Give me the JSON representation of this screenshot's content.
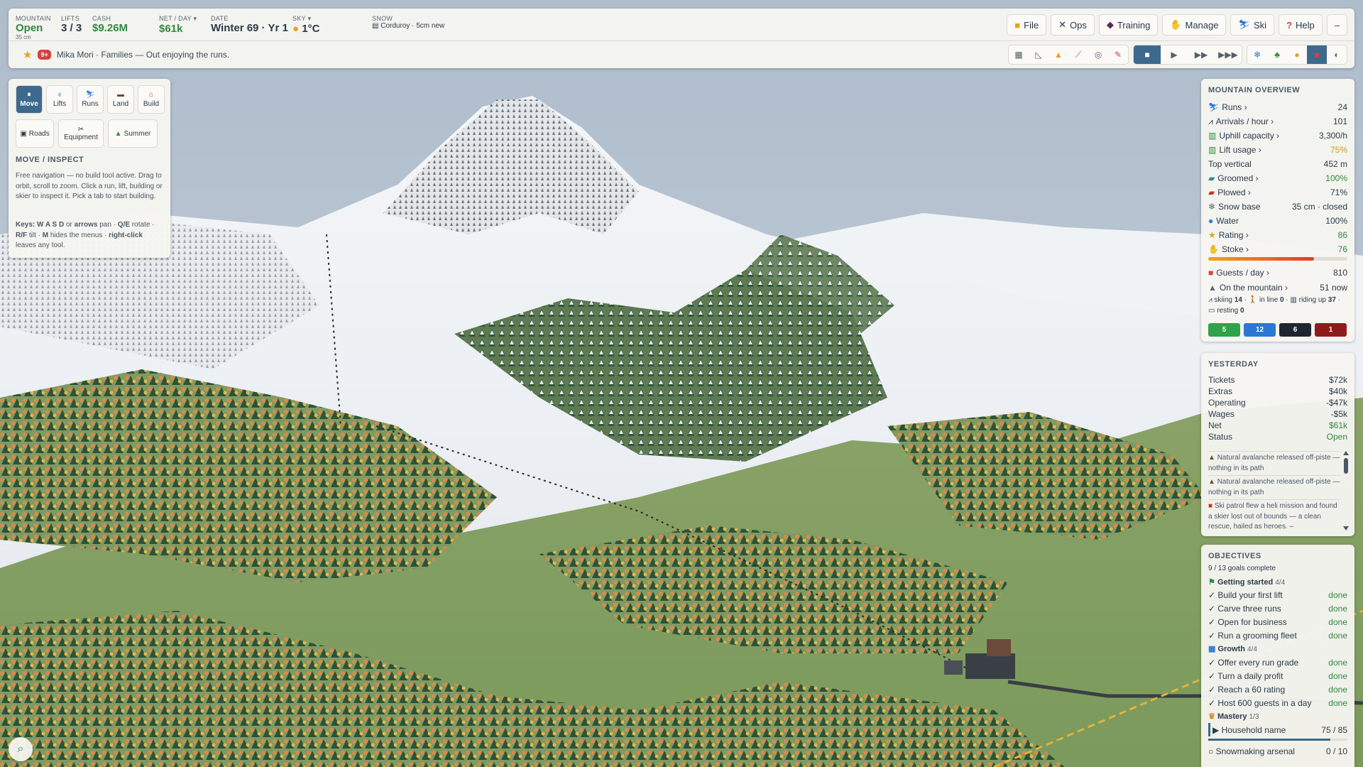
{
  "topbar": {
    "mountain": {
      "label": "Mountain",
      "value": "Open",
      "sub": "35 cm"
    },
    "lifts": {
      "label": "Lifts",
      "value": "3 / 3"
    },
    "cash": {
      "label": "Cash",
      "value": "$9.26M"
    },
    "net": {
      "label": "Net / Day ▾",
      "value": "$61k"
    },
    "date": {
      "label": "Date",
      "value": "Winter 69 · Yr 1"
    },
    "sky": {
      "label": "Sky ▾",
      "value": "1°C"
    },
    "snow": {
      "label": "Snow",
      "value": "Corduroy · 5cm new"
    },
    "menus": [
      "File",
      "Ops",
      "Training",
      "Manage",
      "Ski",
      "Help"
    ],
    "collapse": "–",
    "news": {
      "count": "9+",
      "text": "Mika Mori · Families — Out enjoying the runs."
    }
  },
  "toolpanel": {
    "tabs": [
      "Move",
      "Lifts",
      "Runs",
      "Land",
      "Build"
    ],
    "tabs2": [
      "Roads",
      "Equipment",
      "Summer"
    ],
    "title": "MOVE / INSPECT",
    "desc": "Free navigation — no build tool active. Drag to orbit, scroll to zoom. Click a run, lift, building or skier to inspect it. Pick a tab to start building.",
    "keys": {
      "k1": "Keys:",
      "k2": "W A S D",
      "k3": " or ",
      "k4": "arrows",
      "k5": " pan · ",
      "k6": "Q/E",
      "k7": " rotate · ",
      "k8": "R/F",
      "k9": " tilt · ",
      "k10": "M",
      "k11": " hides the menus · ",
      "k12": "right-click",
      "k13": " leaves any tool."
    }
  },
  "overview": {
    "title": "MOUNTAIN OVERVIEW",
    "rows": [
      {
        "label": "Runs ›",
        "value": "24"
      },
      {
        "label": "Arrivals / hour ›",
        "value": "101"
      },
      {
        "label": "Uphill capacity ›",
        "value": "3,300/h"
      },
      {
        "label": "Lift usage ›",
        "value": "75%"
      },
      {
        "label": "Top vertical",
        "value": "452 m"
      },
      {
        "label": "Groomed ›",
        "value": "100%"
      },
      {
        "label": "Plowed ›",
        "value": "71%"
      },
      {
        "label": "Snow base",
        "value": "35 cm · closed"
      },
      {
        "label": "Water",
        "value": "100%"
      },
      {
        "label": "Rating ›",
        "value": "86"
      },
      {
        "label": "Stoke ›",
        "value": "76"
      }
    ],
    "stoke_fill": 0.76,
    "guests": {
      "label": "Guests / day ›",
      "value": "810"
    },
    "onmtn": {
      "label": "On the mountain ›",
      "value": "51 now"
    },
    "breakdown": {
      "a": "skiing ",
      "b": "14",
      "c": " · ",
      "d": " in line ",
      "e": "0",
      "f": " · ",
      "g": " riding up ",
      "h": "37",
      "i": " · ",
      "j": " resting ",
      "k": "0"
    },
    "grades": [
      {
        "value": "5",
        "color": "#2fa34a"
      },
      {
        "value": "12",
        "color": "#2b78d4"
      },
      {
        "value": "6",
        "color": "#1d2630"
      },
      {
        "value": "1",
        "color": "#8e1c1c"
      }
    ]
  },
  "yesterday": {
    "title": "YESTERDAY",
    "rows": [
      {
        "label": "Tickets",
        "value": "$72k"
      },
      {
        "label": "Extras",
        "value": "$40k"
      },
      {
        "label": "Operating",
        "value": "-$47k"
      },
      {
        "label": "Wages",
        "value": "-$5k"
      },
      {
        "label": "Net",
        "value": "$61k"
      },
      {
        "label": "Status",
        "value": "Open"
      }
    ],
    "log": [
      "Natural avalanche released off-piste — nothing in its path",
      "Natural avalanche released off-piste — nothing in its path",
      "Ski patrol flew a heli mission and found a skier lost out of bounds — a clean rescue, hailed as heroes. –"
    ]
  },
  "objectives": {
    "title": "OBJECTIVES",
    "summary": "9 / 13 goals complete",
    "groups": [
      {
        "name": "Getting started",
        "count": "4/4"
      },
      {
        "name": "Growth",
        "count": "4/4"
      },
      {
        "name": "Mastery",
        "count": "1/3"
      }
    ],
    "items": [
      {
        "name": "✓ Build your first lift",
        "status": "done"
      },
      {
        "name": "✓ Carve three runs",
        "status": "done"
      },
      {
        "name": "✓ Open for business",
        "status": "done"
      },
      {
        "name": "✓ Run a grooming fleet",
        "status": "done"
      },
      {
        "name": "✓ Offer every run grade",
        "status": "done"
      },
      {
        "name": "✓ Turn a daily profit",
        "status": "done"
      },
      {
        "name": "✓ Reach a 60 rating",
        "status": "done"
      },
      {
        "name": "✓ Host 600 guests in a day",
        "status": "done"
      },
      {
        "name": "▶ Household name",
        "status": "75 / 85"
      },
      {
        "name": "○ Snowmaking arsenal",
        "status": "0 / 10"
      }
    ],
    "household_progress": 0.88
  }
}
